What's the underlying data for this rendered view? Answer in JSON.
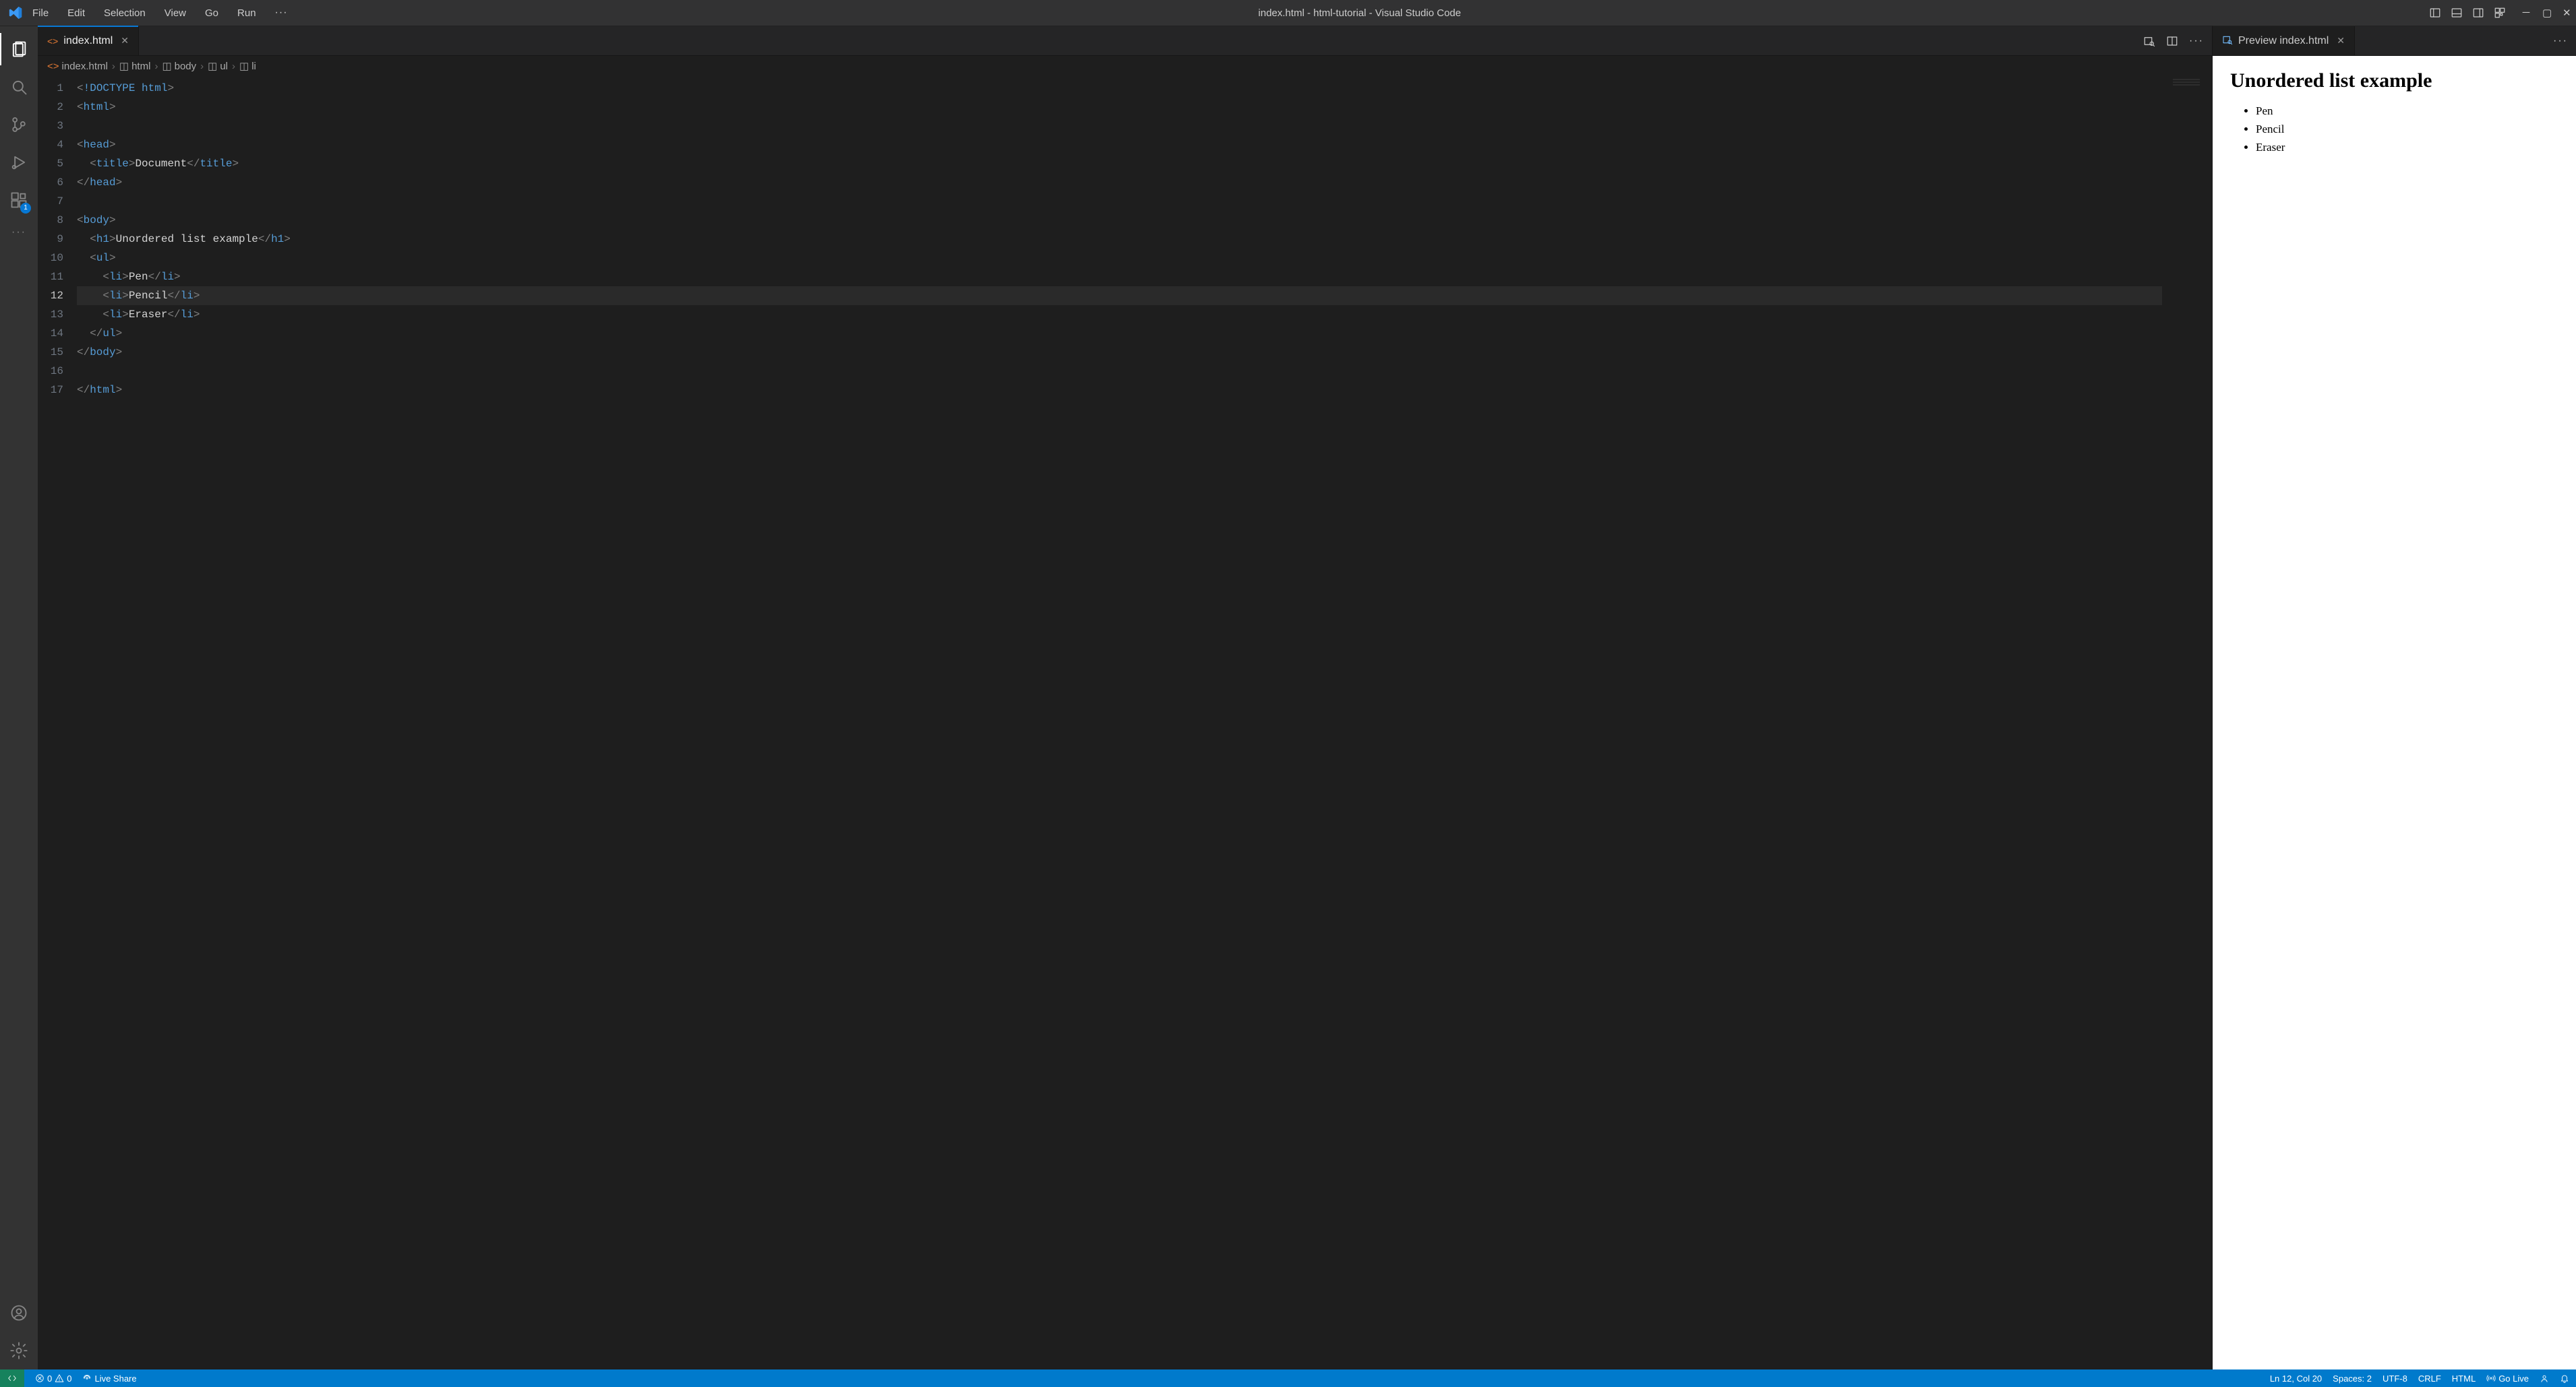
{
  "titlebar": {
    "menus": [
      "File",
      "Edit",
      "Selection",
      "View",
      "Go",
      "Run"
    ],
    "menu_ellipsis": "···",
    "title": "index.html - html-tutorial - Visual Studio Code"
  },
  "activitybar": {
    "extensions_badge": "1"
  },
  "editor": {
    "tab": {
      "label": "index.html"
    },
    "breadcrumbs": [
      "index.html",
      "html",
      "body",
      "ul",
      "li"
    ],
    "lines": {
      "1": {
        "tokens": [
          [
            "<",
            "punct"
          ],
          [
            "!",
            "doctype"
          ],
          [
            "DOCTYPE ",
            "doctype"
          ],
          [
            "html",
            "tag"
          ],
          [
            ">",
            "punct"
          ]
        ]
      },
      "2": {
        "tokens": [
          [
            "<",
            "punct"
          ],
          [
            "html",
            "tag"
          ],
          [
            ">",
            "punct"
          ]
        ]
      },
      "3": {
        "tokens": []
      },
      "4": {
        "tokens": [
          [
            "<",
            "punct"
          ],
          [
            "head",
            "tag"
          ],
          [
            ">",
            "punct"
          ]
        ]
      },
      "5": {
        "tokens": [
          [
            "  ",
            "text"
          ],
          [
            "<",
            "punct"
          ],
          [
            "title",
            "tag"
          ],
          [
            ">",
            "punct"
          ],
          [
            "Document",
            "text"
          ],
          [
            "</",
            "punct"
          ],
          [
            "title",
            "tag"
          ],
          [
            ">",
            "punct"
          ]
        ]
      },
      "6": {
        "tokens": [
          [
            "</",
            "punct"
          ],
          [
            "head",
            "tag"
          ],
          [
            ">",
            "punct"
          ]
        ]
      },
      "7": {
        "tokens": []
      },
      "8": {
        "tokens": [
          [
            "<",
            "punct"
          ],
          [
            "body",
            "tag"
          ],
          [
            ">",
            "punct"
          ]
        ]
      },
      "9": {
        "tokens": [
          [
            "  ",
            "text"
          ],
          [
            "<",
            "punct"
          ],
          [
            "h1",
            "tag"
          ],
          [
            ">",
            "punct"
          ],
          [
            "Unordered list example",
            "text"
          ],
          [
            "</",
            "punct"
          ],
          [
            "h1",
            "tag"
          ],
          [
            ">",
            "punct"
          ]
        ]
      },
      "10": {
        "tokens": [
          [
            "  ",
            "text"
          ],
          [
            "<",
            "punct"
          ],
          [
            "ul",
            "tag"
          ],
          [
            ">",
            "punct"
          ]
        ]
      },
      "11": {
        "tokens": [
          [
            "    ",
            "text"
          ],
          [
            "<",
            "punct"
          ],
          [
            "li",
            "tag"
          ],
          [
            ">",
            "punct"
          ],
          [
            "Pen",
            "text"
          ],
          [
            "</",
            "punct"
          ],
          [
            "li",
            "tag"
          ],
          [
            ">",
            "punct"
          ]
        ]
      },
      "12": {
        "tokens": [
          [
            "    ",
            "text"
          ],
          [
            "<",
            "punct"
          ],
          [
            "li",
            "tag"
          ],
          [
            ">",
            "punct"
          ],
          [
            "Pencil",
            "text"
          ],
          [
            "</",
            "punct"
          ],
          [
            "li",
            "tag"
          ],
          [
            ">",
            "punct"
          ]
        ],
        "current": true
      },
      "13": {
        "tokens": [
          [
            "    ",
            "text"
          ],
          [
            "<",
            "punct"
          ],
          [
            "li",
            "tag"
          ],
          [
            ">",
            "punct"
          ],
          [
            "Eraser",
            "text"
          ],
          [
            "</",
            "punct"
          ],
          [
            "li",
            "tag"
          ],
          [
            ">",
            "punct"
          ]
        ]
      },
      "14": {
        "tokens": [
          [
            "  ",
            "text"
          ],
          [
            "</",
            "punct"
          ],
          [
            "ul",
            "tag"
          ],
          [
            ">",
            "punct"
          ]
        ]
      },
      "15": {
        "tokens": [
          [
            "</",
            "punct"
          ],
          [
            "body",
            "tag"
          ],
          [
            ">",
            "punct"
          ]
        ]
      },
      "16": {
        "tokens": []
      },
      "17": {
        "tokens": [
          [
            "</",
            "punct"
          ],
          [
            "html",
            "tag"
          ],
          [
            ">",
            "punct"
          ]
        ]
      }
    },
    "line_count": 17,
    "current_line": 12
  },
  "preview": {
    "tab_label": "Preview index.html",
    "heading": "Unordered list example",
    "items": [
      "Pen",
      "Pencil",
      "Eraser"
    ]
  },
  "statusbar": {
    "errors": "0",
    "warnings": "0",
    "live_share": "Live Share",
    "cursor": "Ln 12, Col 20",
    "spaces": "Spaces: 2",
    "encoding": "UTF-8",
    "eol": "CRLF",
    "lang": "HTML",
    "go_live": "Go Live"
  }
}
